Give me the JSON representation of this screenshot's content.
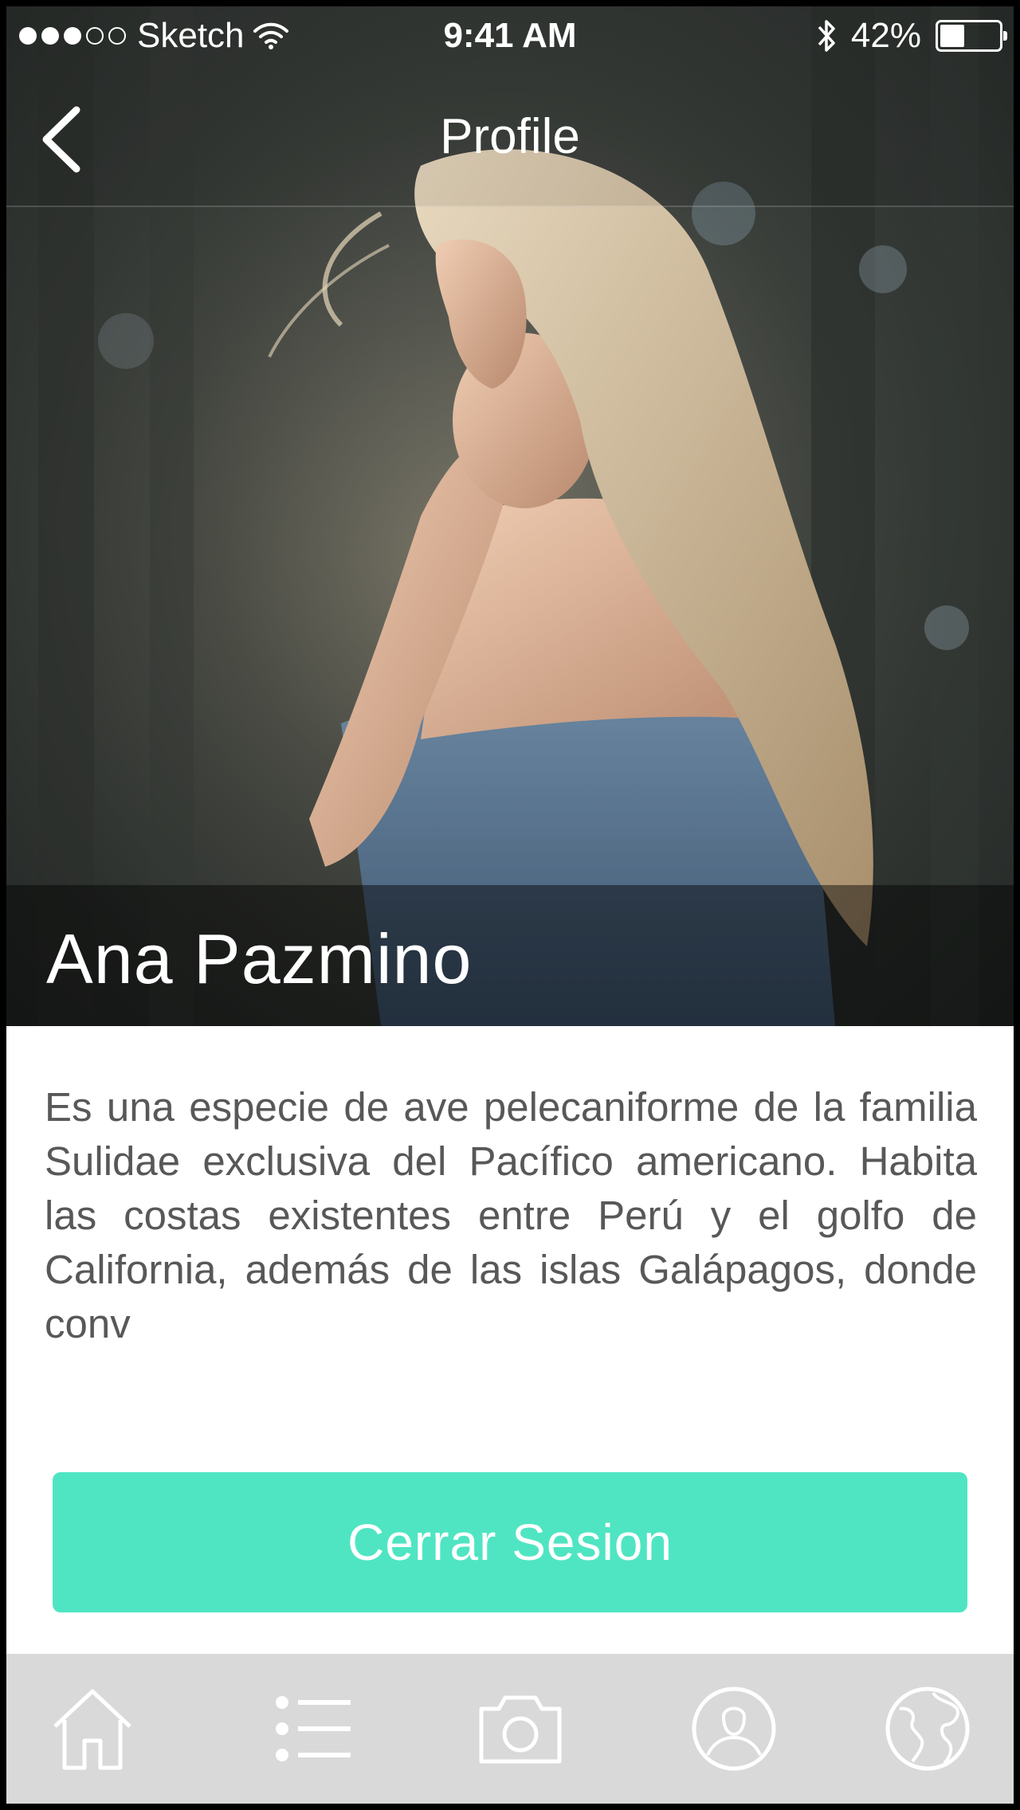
{
  "status_bar": {
    "signal_dots_filled": 3,
    "signal_dots_total": 5,
    "carrier": "Sketch",
    "time": "9:41 AM",
    "battery_percent": "42%",
    "battery_level": 0.42,
    "icons": [
      "wifi-icon",
      "bluetooth-icon",
      "battery-icon"
    ]
  },
  "nav": {
    "title": "Profile",
    "back_icon": "chevron-left-icon"
  },
  "profile": {
    "name": "Ana Pazmino",
    "bio": "Es una especie de ave pelecaniforme de la familia Sulidae exclusiva del Pacífico americano. Habita las costas existentes entre Perú y el golfo de California, además de las islas Galápagos, donde conv"
  },
  "actions": {
    "logout_label": "Cerrar Sesion"
  },
  "tab_bar": {
    "tabs": [
      "home-icon",
      "list-icon",
      "camera-icon",
      "user-icon",
      "globe-icon"
    ]
  },
  "colors": {
    "accent": "#4fe5c2",
    "tab_bar_bg": "#d9d9d9",
    "body_text": "#585858"
  }
}
